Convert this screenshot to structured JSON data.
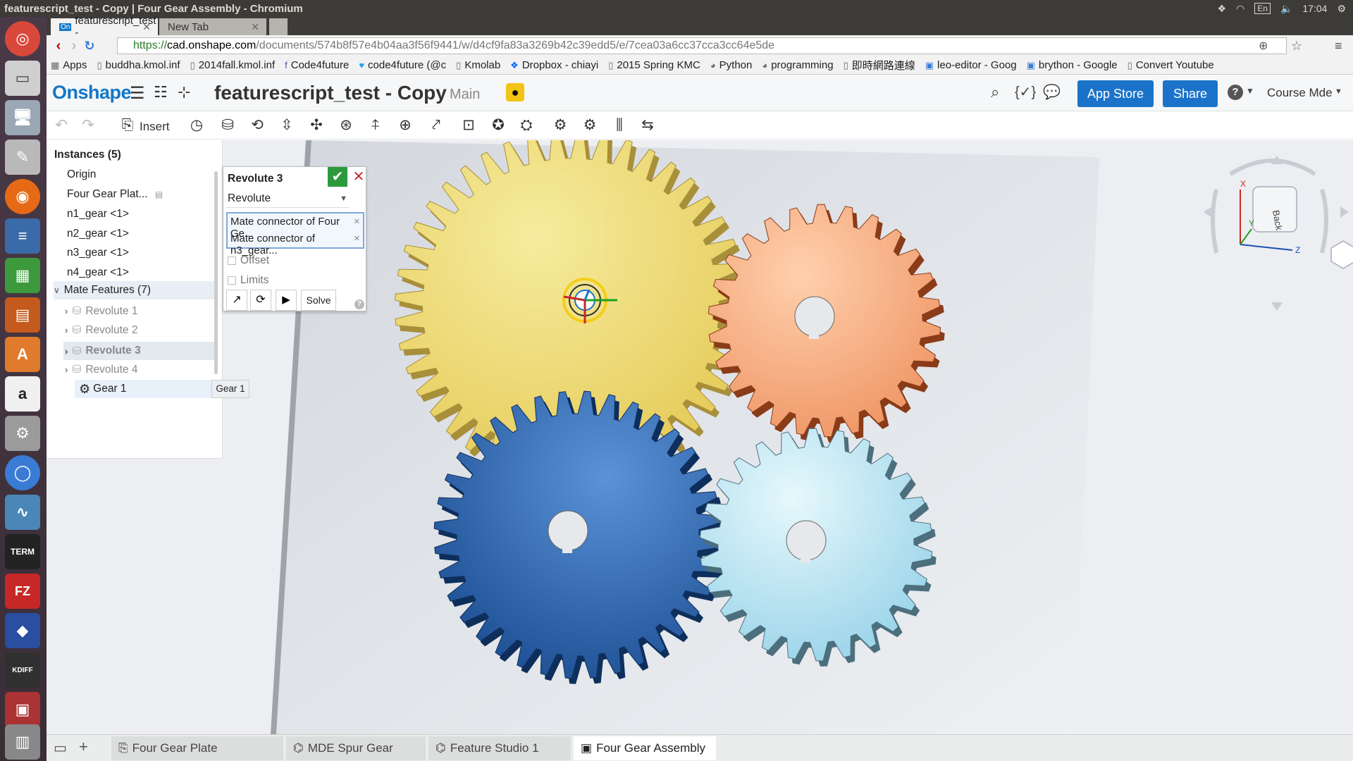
{
  "os": {
    "window_title": "featurescript_test - Copy | Four Gear Assembly - Chromium",
    "clock": "17:04",
    "lang": "En"
  },
  "browser": {
    "tabs": [
      {
        "label": "featurescript_test -"
      },
      {
        "label": "New Tab"
      }
    ],
    "url_scheme": "https://",
    "url_domain": "cad.onshape.com",
    "url_path": "/documents/574b8f57e4b04aa3f56f9441/w/d4cf9fa83a3269b42c39edd5/e/7cea03a6cc37cca3cc64e5de",
    "bookmarks": [
      {
        "label": "Apps",
        "icon": "apps-grid-icon"
      },
      {
        "label": "buddha.kmol.inf",
        "icon": "page-icon"
      },
      {
        "label": "2014fall.kmol.inf",
        "icon": "page-icon"
      },
      {
        "label": "Code4future",
        "icon": "facebook-icon"
      },
      {
        "label": "code4future (@c",
        "icon": "twitter-icon"
      },
      {
        "label": "Kmolab",
        "icon": "page-icon"
      },
      {
        "label": "Dropbox - chiayi",
        "icon": "dropbox-icon"
      },
      {
        "label": "2015 Spring KMC",
        "icon": "page-icon"
      },
      {
        "label": "Python",
        "icon": "github-icon"
      },
      {
        "label": "programming",
        "icon": "github-icon"
      },
      {
        "label": "即時網路連線",
        "icon": "page-icon"
      },
      {
        "label": "leo-editor - Goog",
        "icon": "google-groups-icon"
      },
      {
        "label": "brython - Google",
        "icon": "google-groups-icon"
      },
      {
        "label": "Convert Youtube",
        "icon": "page-icon"
      }
    ]
  },
  "header": {
    "logo": "Onshape",
    "doc_title": "featurescript_test - Copy",
    "branch": "Main",
    "app_store": "App Store",
    "share": "Share",
    "help": "?",
    "user": "Course Mde"
  },
  "toolbar": {
    "insert_label": "Insert"
  },
  "instances": {
    "title": "Instances (5)",
    "items": [
      "Origin",
      "Four Gear Plat...",
      "n1_gear <1>",
      "n2_gear <1>",
      "n3_gear <1>",
      "n4_gear <1>"
    ],
    "mate_header": "Mate Features (7)",
    "mates": [
      "Revolute 1",
      "Revolute 2",
      "Revolute 3",
      "Revolute 4"
    ],
    "gear": "Gear 1",
    "tooltip": "Gear 1"
  },
  "revolute_panel": {
    "title": "Revolute 3",
    "type": "Revolute",
    "connectors": [
      "Mate connector of Four Ge...",
      "Mate connector of n3_gear..."
    ],
    "offset_label": "Offset",
    "limits_label": "Limits",
    "solve": "Solve"
  },
  "viewcube": {
    "face": "Back",
    "axes": [
      "X",
      "Y",
      "Z"
    ]
  },
  "bottom_tabs": [
    {
      "label": "Four Gear Plate",
      "icon": "part-studio-icon"
    },
    {
      "label": "MDE Spur Gear",
      "icon": "feature-studio-icon"
    },
    {
      "label": "Feature Studio 1",
      "icon": "feature-studio-icon"
    },
    {
      "label": "Four Gear Assembly",
      "icon": "assembly-icon"
    }
  ],
  "colors": {
    "accent": "#1a73c9",
    "gear_yellow": "#efd774",
    "gear_orange": "#f7b08a",
    "gear_blue": "#2c68b4",
    "gear_cyan": "#bde7f4"
  }
}
